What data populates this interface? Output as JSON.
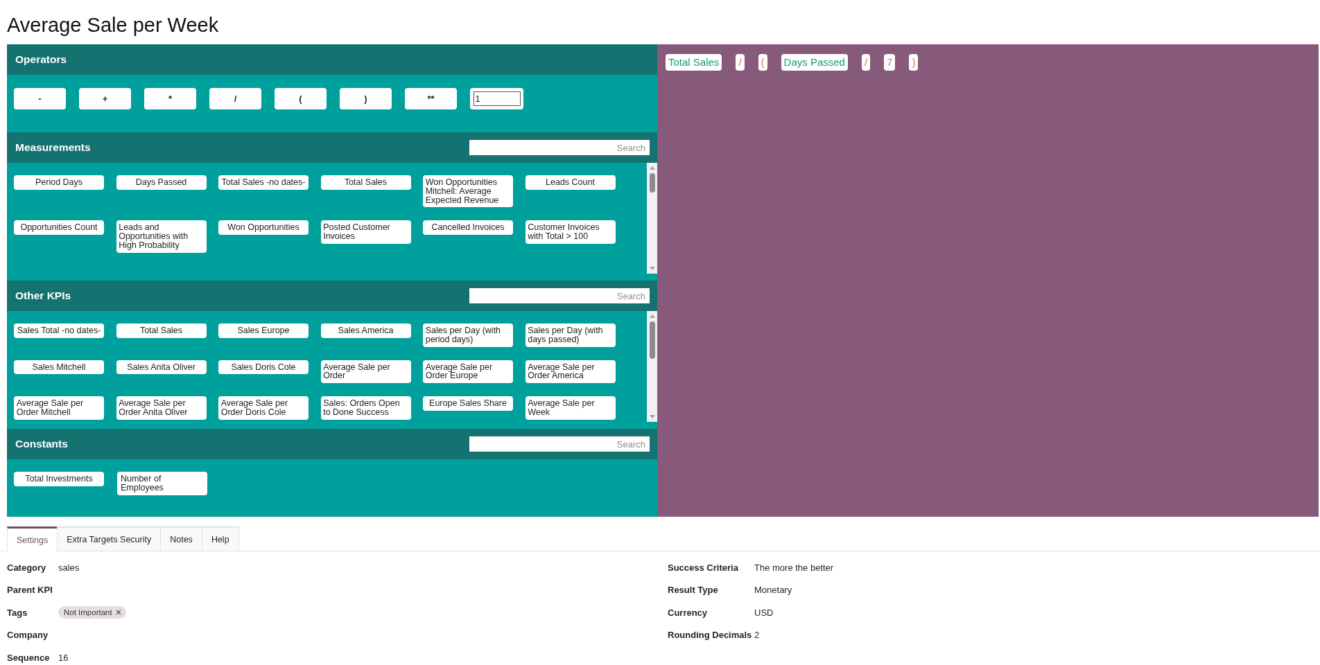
{
  "title": "Average Sale per Week",
  "operators": {
    "title": "Operators",
    "buttons": [
      "-",
      "+",
      "*",
      "/",
      "(",
      ")",
      "**"
    ],
    "number_input": {
      "value": "1"
    }
  },
  "lists": [
    {
      "title": "Measurements",
      "search": {
        "placeholder": "Search"
      },
      "scrollable": true,
      "items": [
        "Period Days",
        "Days Passed",
        "Total Sales -no dates-",
        "Total Sales",
        "Won Opportunities Mitchell: Average Expected Revenue",
        "Leads Count",
        "Opportunities Count",
        "Leads and Opportunities with High Probability",
        "Won Opportunities",
        "Posted Customer Invoices",
        "Cancelled Invoices",
        "Customer Invoices with Total > 100"
      ]
    },
    {
      "title": "Other KPIs",
      "search": {
        "placeholder": "Search"
      },
      "scrollable": true,
      "items": [
        "Sales Total -no dates-",
        "Total Sales",
        "Sales Europe",
        "Sales America",
        "Sales per Day (with period days)",
        "Sales per Day (with days passed)",
        "Sales Mitchell",
        "Sales Anita Oliver",
        "Sales Doris Cole",
        "Average Sale per Order",
        "Average Sale per Order Europe",
        "Average Sale per Order America",
        "Average Sale per Order Mitchell",
        "Average Sale per Order Anita Oliver",
        "Average Sale per Order Doris Cole",
        "Sales: Orders Open to Done Success",
        "Europe Sales Share",
        "Average Sale per Week"
      ]
    },
    {
      "title": "Constants",
      "search": {
        "placeholder": "Search"
      },
      "scrollable": false,
      "items": [
        "Total Investments",
        "Number of Employees"
      ]
    }
  ],
  "formula": [
    {
      "text": "Total Sales",
      "kind": "measurement"
    },
    {
      "text": "/",
      "kind": "operator"
    },
    {
      "text": "(",
      "kind": "operator"
    },
    {
      "text": "Days Passed",
      "kind": "measurement"
    },
    {
      "text": "/",
      "kind": "operator"
    },
    {
      "text": "7",
      "kind": "number"
    },
    {
      "text": ")",
      "kind": "operator"
    }
  ],
  "tabs": [
    {
      "label": "Settings",
      "selected": true
    },
    {
      "label": "Extra Targets Security",
      "selected": false
    },
    {
      "label": "Notes",
      "selected": false
    },
    {
      "label": "Help",
      "selected": false
    }
  ],
  "fields": {
    "left": [
      {
        "label": "Category",
        "value": "sales"
      },
      {
        "label": "Parent KPI"
      },
      {
        "label": "Tags",
        "tags": [
          "Not Important"
        ]
      },
      {
        "label": "Company"
      },
      {
        "label": "Sequence",
        "value": "16"
      }
    ],
    "right": [
      {
        "label": "Success Criteria",
        "value": "The more the better"
      },
      {
        "label": "Result Type",
        "value": "Monetary"
      },
      {
        "label": "Currency",
        "value": "USD"
      },
      {
        "label": "Rounding Decimals",
        "value": "2"
      }
    ]
  }
}
